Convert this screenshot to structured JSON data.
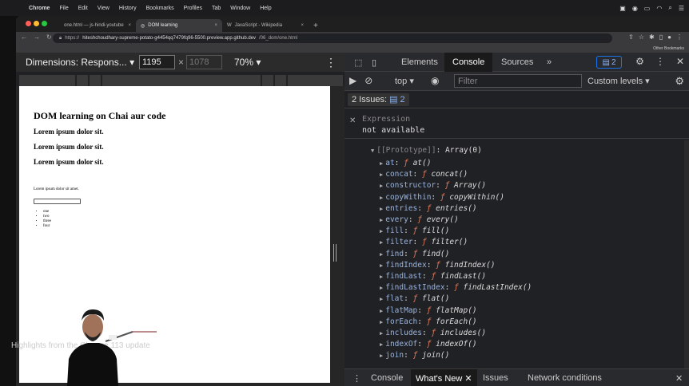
{
  "menubar": {
    "app": "Chrome",
    "items": [
      "File",
      "Edit",
      "View",
      "History",
      "Bookmarks",
      "Profiles",
      "Tab",
      "Window",
      "Help"
    ]
  },
  "tabs": [
    {
      "label": "one.html — js-hindi-youtube",
      "close": "×"
    },
    {
      "label": "DOM learning",
      "close": "×"
    },
    {
      "label": "JavaScript - Wikipedia",
      "close": "×"
    }
  ],
  "new_tab": "+",
  "url": {
    "prefix": "https://",
    "host": "hiteshchoudhary-supreme-potato-g4454qq7479fq96-5500.preview.app.github.dev",
    "path": "/06_dom/one.html"
  },
  "bookmarks": {
    "other": "Other Bookmarks"
  },
  "device_toolbar": {
    "dimensions": "Dimensions: Respons...",
    "width": "1195",
    "times": "×",
    "height": "1078",
    "zoom": "70%",
    "more": "⋮"
  },
  "page": {
    "heading": "DOM learning on Chai aur code",
    "subheadings": [
      "Lorem ipsum dolor sit.",
      "Lorem ipsum dolor sit.",
      "Lorem ipsum dolor sit."
    ],
    "paragraph": "Lorem ipsum dolor sit amet.",
    "list": [
      "one",
      "two",
      "three",
      "four"
    ]
  },
  "devtools": {
    "tabs": [
      "Elements",
      "Console",
      "Sources"
    ],
    "active_tab": "Console",
    "more_tabs": "»",
    "issues_count": "2",
    "context": "top",
    "filter_placeholder": "Filter",
    "levels": "Custom levels",
    "issues_label": "2 Issues:",
    "issues_num": "2",
    "expression_label": "Expression",
    "expression_value": "not available",
    "prototype": {
      "key": "[[Prototype]]",
      "value": "Array(0)"
    },
    "methods": [
      {
        "key": "at",
        "sig": "at()"
      },
      {
        "key": "concat",
        "sig": "concat()"
      },
      {
        "key": "constructor",
        "sig": "Array()"
      },
      {
        "key": "copyWithin",
        "sig": "copyWithin()"
      },
      {
        "key": "entries",
        "sig": "entries()"
      },
      {
        "key": "every",
        "sig": "every()"
      },
      {
        "key": "fill",
        "sig": "fill()"
      },
      {
        "key": "filter",
        "sig": "filter()"
      },
      {
        "key": "find",
        "sig": "find()"
      },
      {
        "key": "findIndex",
        "sig": "findIndex()"
      },
      {
        "key": "findLast",
        "sig": "findLast()"
      },
      {
        "key": "findLastIndex",
        "sig": "findLastIndex()"
      },
      {
        "key": "flat",
        "sig": "flat()"
      },
      {
        "key": "flatMap",
        "sig": "flatMap()"
      },
      {
        "key": "forEach",
        "sig": "forEach()"
      },
      {
        "key": "includes",
        "sig": "includes()"
      },
      {
        "key": "indexOf",
        "sig": "indexOf()"
      },
      {
        "key": "join",
        "sig": "join()"
      }
    ],
    "drawer_tabs": [
      "Console",
      "What's New",
      "Issues",
      "Network conditions"
    ],
    "drawer_active": "What's New",
    "highlights": "Highlights from the Chrome 113 update"
  },
  "colors": {
    "key": "#9ab4e0",
    "fn": "#e37b5b",
    "accent": "#1a73e8"
  }
}
